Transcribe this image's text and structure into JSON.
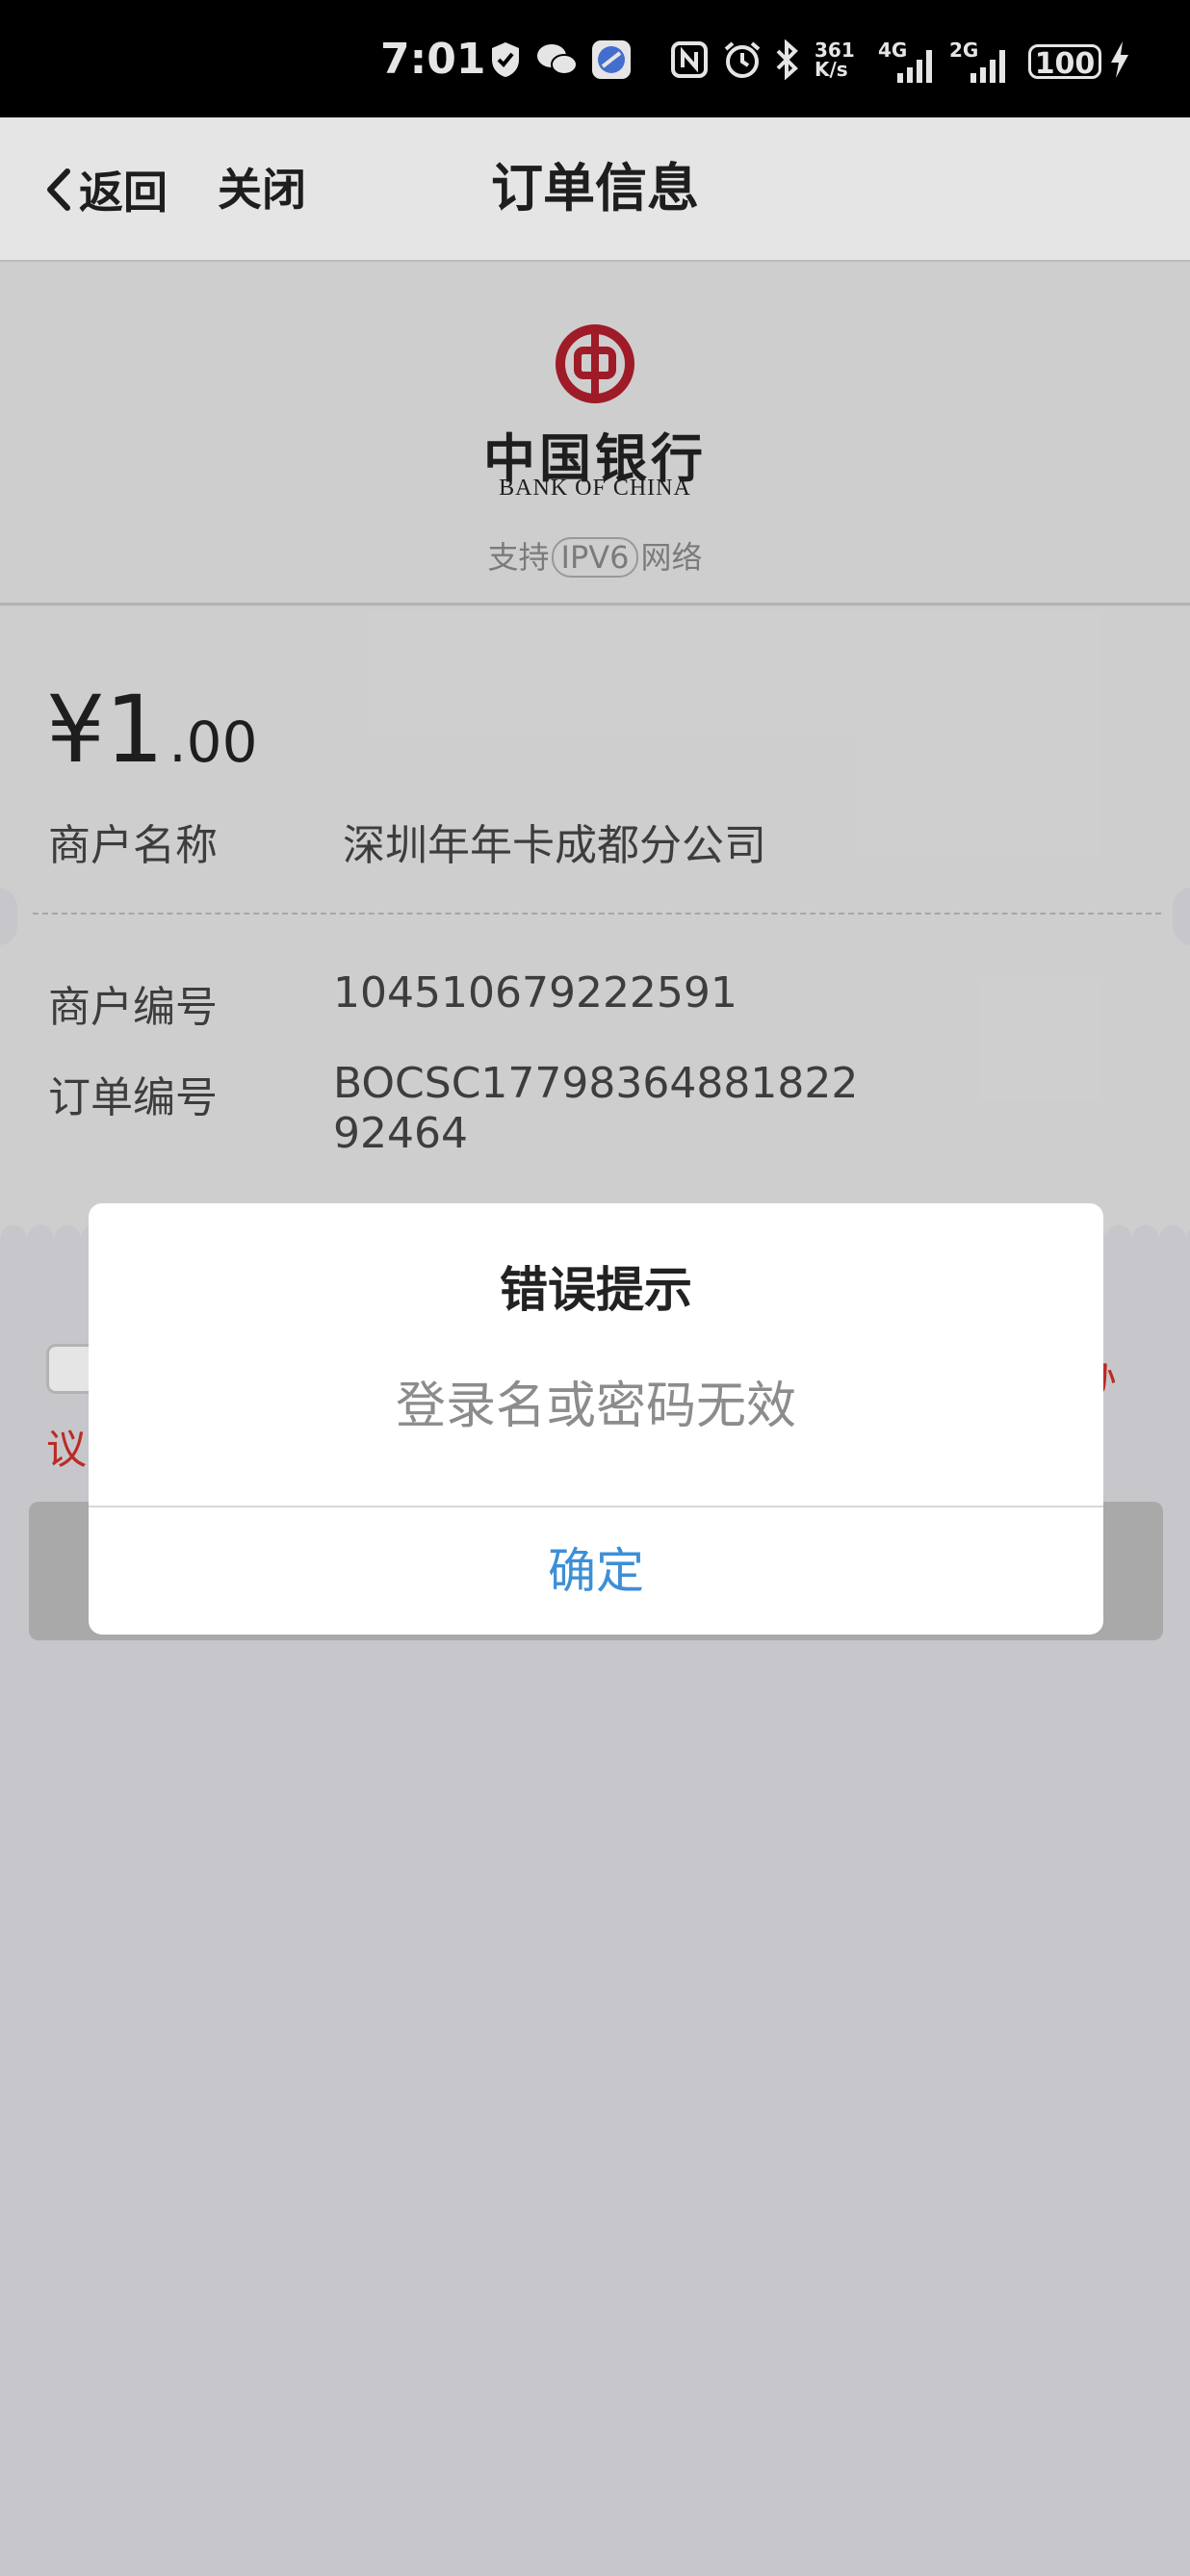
{
  "status_bar": {
    "time": "7:01",
    "net_speed": "361\nK/s",
    "net_4g": "4G",
    "net_2g": "2G",
    "battery": "100",
    "icons": [
      "shield-check-icon",
      "wechat-icon",
      "app-icon",
      "nfc-icon",
      "alarm-icon",
      "bluetooth-icon",
      "signal-icon",
      "charging-icon"
    ]
  },
  "nav": {
    "back_label": "返回",
    "close_label": "关闭",
    "title": "订单信息"
  },
  "bank": {
    "name_cn": "中国银行",
    "name_en": "BANK OF CHINA",
    "brand_color": "#b21f2d",
    "ipv6_prefix": "支持",
    "ipv6_badge": "IPV6",
    "ipv6_suffix": "网络"
  },
  "order": {
    "currency": "¥",
    "amount_int": "1",
    "amount_dec": ".00",
    "merchant_name_label": "商户名称",
    "merchant_name": "深圳年年卡成都分公司",
    "merchant_no_label": "商户编号",
    "merchant_no": "104510679222591",
    "order_no_label": "订单编号",
    "order_no_line1": "BOCSC17798364881822",
    "order_no_line2": "92464"
  },
  "form": {
    "agreement_partial_1": "办",
    "agreement_partial_2": "议"
  },
  "dialog": {
    "title": "错误提示",
    "message": "登录名或密码无效",
    "ok_label": "确定",
    "ok_color": "#3d8fd6"
  }
}
